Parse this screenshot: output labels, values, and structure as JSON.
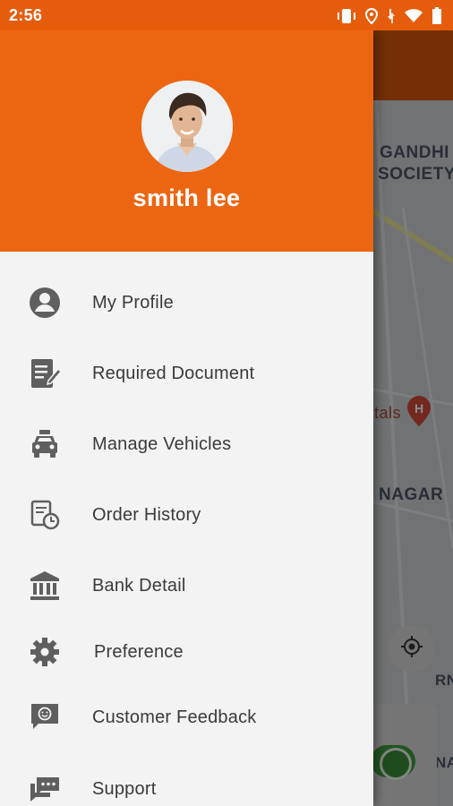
{
  "status_bar": {
    "time": "2:56",
    "icons": [
      "vibrate-icon",
      "location-icon",
      "data-icon",
      "wifi-icon",
      "battery-icon"
    ]
  },
  "colors": {
    "header_orange": "#ec6611",
    "status_orange": "#e65c0d",
    "drawer_bg": "#f3f3f3",
    "icon_gray": "#5f5f5f",
    "toggle_green": "#3d9a3d"
  },
  "drawer": {
    "user_name": "smith lee",
    "menu": [
      {
        "label": "My Profile",
        "icon": "account-circle-icon"
      },
      {
        "label": "Required Document",
        "icon": "document-edit-icon"
      },
      {
        "label": "Manage Vehicles",
        "icon": "car-icon"
      },
      {
        "label": "Order History",
        "icon": "history-icon"
      },
      {
        "label": "Bank Detail",
        "icon": "bank-icon"
      },
      {
        "label": "Preference",
        "icon": "gear-icon"
      },
      {
        "label": "Customer Feedback",
        "icon": "feedback-icon"
      },
      {
        "label": "Support",
        "icon": "support-chat-icon"
      }
    ]
  },
  "map": {
    "labels": [
      "GANDHI",
      "SOCIETY",
      "tals",
      "NAGAR",
      "RN",
      "NA"
    ]
  }
}
